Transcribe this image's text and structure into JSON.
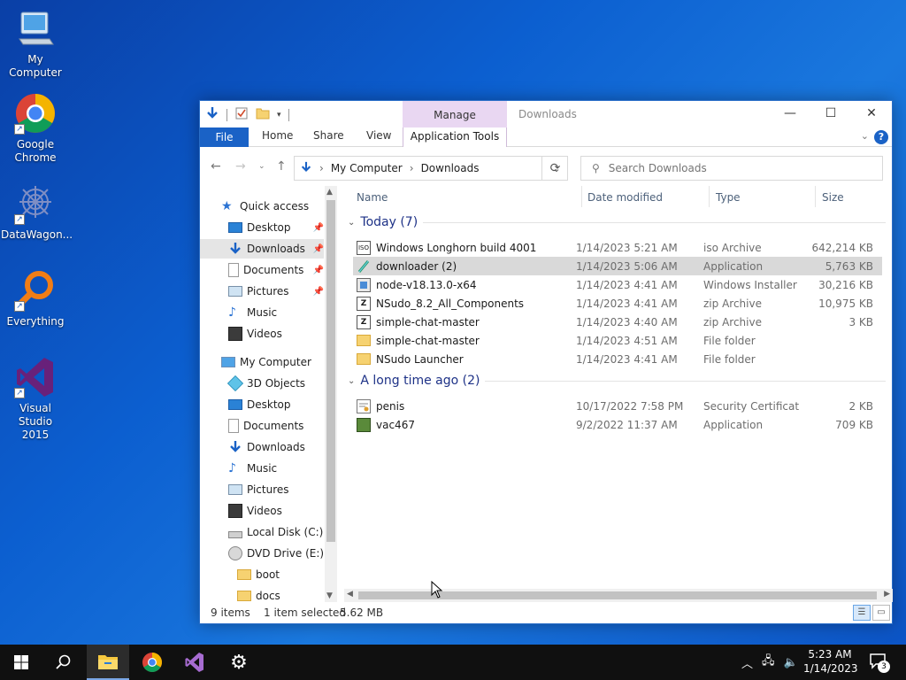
{
  "desktop": {
    "icons": [
      {
        "label": "My Computer"
      },
      {
        "label": "Google Chrome"
      },
      {
        "label": "DataWagon..."
      },
      {
        "label": "Everything"
      },
      {
        "label": "Visual Studio 2015"
      }
    ]
  },
  "window": {
    "title": "Downloads",
    "contextual_tab_group": "Manage",
    "ribbon_tabs": [
      "File",
      "Home",
      "Share",
      "View",
      "Application Tools"
    ],
    "breadcrumb": [
      "My Computer",
      "Downloads"
    ],
    "search_placeholder": "Search Downloads",
    "nav": {
      "quick_access_label": "Quick access",
      "quick_access": [
        {
          "label": "Desktop",
          "pinned": true
        },
        {
          "label": "Downloads",
          "pinned": true
        },
        {
          "label": "Documents",
          "pinned": true
        },
        {
          "label": "Pictures",
          "pinned": true
        },
        {
          "label": "Music",
          "pinned": false
        },
        {
          "label": "Videos",
          "pinned": false
        }
      ],
      "this_pc_label": "My Computer",
      "this_pc": [
        {
          "label": "3D Objects"
        },
        {
          "label": "Desktop"
        },
        {
          "label": "Documents"
        },
        {
          "label": "Downloads"
        },
        {
          "label": "Music"
        },
        {
          "label": "Pictures"
        },
        {
          "label": "Videos"
        },
        {
          "label": "Local Disk (C:)"
        },
        {
          "label": "DVD Drive (E:) LE"
        }
      ],
      "subfolders": [
        {
          "label": "boot"
        },
        {
          "label": "docs"
        }
      ]
    },
    "columns": {
      "name": "Name",
      "date": "Date modified",
      "type": "Type",
      "size": "Size"
    },
    "groups": [
      {
        "label": "Today (7)",
        "files": [
          {
            "name": "Windows Longhorn build 4001",
            "date": "1/14/2023 5:21 AM",
            "type": "iso Archive",
            "size": "642,214 KB",
            "icon": "iso-icon"
          },
          {
            "name": "downloader (2)",
            "date": "1/14/2023 5:06 AM",
            "type": "Application",
            "size": "5,763 KB",
            "icon": "app-icon",
            "selected": true
          },
          {
            "name": "node-v18.13.0-x64",
            "date": "1/14/2023 4:41 AM",
            "type": "Windows Installer ...",
            "size": "30,216 KB",
            "icon": "installer-icon"
          },
          {
            "name": "NSudo_8.2_All_Components",
            "date": "1/14/2023 4:41 AM",
            "type": "zip Archive",
            "size": "10,975 KB",
            "icon": "zip-icon"
          },
          {
            "name": "simple-chat-master",
            "date": "1/14/2023 4:40 AM",
            "type": "zip Archive",
            "size": "3 KB",
            "icon": "zip-icon"
          },
          {
            "name": "simple-chat-master",
            "date": "1/14/2023 4:51 AM",
            "type": "File folder",
            "size": "",
            "icon": "folder-icon"
          },
          {
            "name": "NSudo Launcher",
            "date": "1/14/2023 4:41 AM",
            "type": "File folder",
            "size": "",
            "icon": "folder-icon"
          }
        ]
      },
      {
        "label": "A long time ago (2)",
        "files": [
          {
            "name": "penis",
            "date": "10/17/2022 7:58 PM",
            "type": "Security Certificate",
            "size": "2 KB",
            "icon": "certificate-icon"
          },
          {
            "name": "vac467",
            "date": "9/2/2022 11:37 AM",
            "type": "Application",
            "size": "709 KB",
            "icon": "app-icon"
          }
        ]
      }
    ],
    "status": {
      "items": "9 items",
      "selected": "1 item selected",
      "size": "5.62 MB"
    }
  },
  "taskbar": {
    "time": "5:23 AM",
    "date": "1/14/2023",
    "notification_count": "3"
  },
  "colors": {
    "accent": "#1a62c6",
    "manage_tab": "#e9d7f2",
    "selected_row": "#d9d9d9",
    "group_header": "#1e3287"
  }
}
